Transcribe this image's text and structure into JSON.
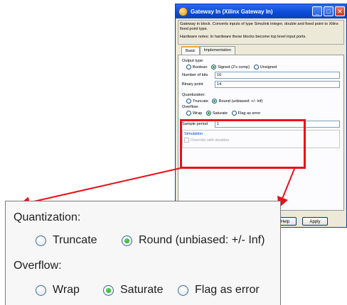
{
  "dialog": {
    "title": "Gateway In (Xilinx Gateway In)",
    "description": "Gateway in block. Converts inputs of type Simulink integer, double and fixed point to Xilinx fixed point type.",
    "hardware_notes": "Hardware notes: In hardware these blocks become top level input ports.",
    "tabs": [
      "Basic",
      "Implementation"
    ],
    "active_tab": "Basic",
    "output_type": {
      "label": "Output type:",
      "options": [
        "Boolean",
        "Signed (2's comp)",
        "Unsigned"
      ],
      "selected": "Signed (2's comp)"
    },
    "number_of_bits": {
      "label": "Number of bits",
      "value": "16"
    },
    "binary_point": {
      "label": "Binary point",
      "value": "14"
    },
    "quantization": {
      "label": "Quantization:",
      "options": [
        "Truncate",
        "Round (unbiased: +/- Inf)"
      ],
      "selected": "Round (unbiased: +/- Inf)"
    },
    "overflow": {
      "label": "Overflow:",
      "options": [
        "Wrap",
        "Saturate",
        "Flag as error"
      ],
      "selected": "Saturate"
    },
    "sample_period": {
      "label": "Sample period",
      "value": "1"
    },
    "simulation": {
      "label": "Simulation",
      "override_label": "Override with doubles"
    },
    "buttons": {
      "help": "Help",
      "apply": "Apply"
    }
  },
  "zoom": {
    "quantization_label": "Quantization:",
    "quantization_options": [
      "Truncate",
      "Round (unbiased: +/- Inf)"
    ],
    "overflow_label": "Overflow:",
    "overflow_options": [
      "Wrap",
      "Saturate",
      "Flag as error"
    ]
  },
  "colors": {
    "highlight": "#e8101a",
    "titlebar": "#0a4bd6",
    "radio_on": "#21a121"
  }
}
